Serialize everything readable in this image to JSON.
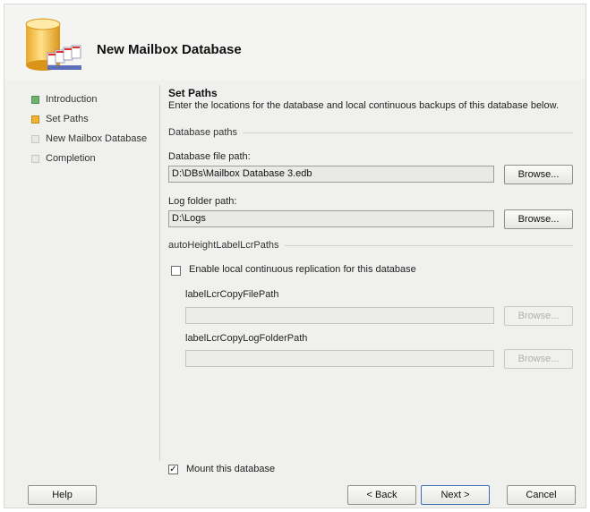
{
  "dialog": {
    "title": "New Mailbox Database",
    "header_icon": "database-icon"
  },
  "steps": [
    {
      "label": "Introduction",
      "state": "done",
      "color": "#6db36d"
    },
    {
      "label": "Set Paths",
      "state": "current",
      "color": "#f2b233"
    },
    {
      "label": "New Mailbox Database",
      "state": "pending",
      "color": "#e8e8e6"
    },
    {
      "label": "Completion",
      "state": "pending",
      "color": "#e8e8e6"
    }
  ],
  "content": {
    "title": "Set Paths",
    "description": "Enter the locations for the database and local continuous backups of this database below.",
    "database_paths_group": "Database paths",
    "db_file_label": "Database file path:",
    "db_file_value": "D:\\DBs\\Mailbox Database 3.edb",
    "log_folder_label": "Log folder path:",
    "log_folder_value": "D:\\Logs",
    "browse_label": "Browse...",
    "lcr_group": "autoHeightLabelLcrPaths",
    "lcr_checkbox_label": "Enable local continuous replication for this database",
    "lcr_checked": false,
    "lcr_copy_file_label": "labelLcrCopyFilePath",
    "lcr_copy_file_value": "",
    "lcr_copy_log_label": "labelLcrCopyLogFolderPath",
    "lcr_copy_log_value": "",
    "mount_label": "Mount this database",
    "mount_checked": true
  },
  "footer": {
    "help": "Help",
    "back": "< Back",
    "next": "Next >",
    "cancel": "Cancel"
  }
}
